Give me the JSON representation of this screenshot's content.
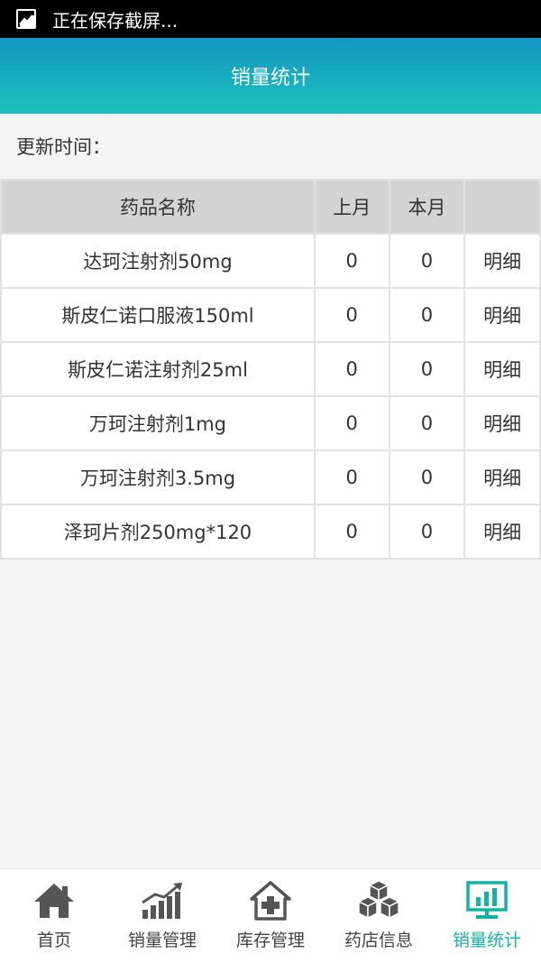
{
  "status_bar": {
    "text": "正在保存截屏..."
  },
  "header": {
    "title": "销量统计"
  },
  "update": {
    "label": "更新时间："
  },
  "table": {
    "headers": [
      "药品名称",
      "上月",
      "本月",
      ""
    ],
    "rows": [
      {
        "name": "达珂注射剂50mg",
        "last": "0",
        "this": "0",
        "detail": "明细"
      },
      {
        "name": "斯皮仁诺口服液150ml",
        "last": "0",
        "this": "0",
        "detail": "明细"
      },
      {
        "name": "斯皮仁诺注射剂25ml",
        "last": "0",
        "this": "0",
        "detail": "明细"
      },
      {
        "name": "万珂注射剂1mg",
        "last": "0",
        "this": "0",
        "detail": "明细"
      },
      {
        "name": "万珂注射剂3.5mg",
        "last": "0",
        "this": "0",
        "detail": "明细"
      },
      {
        "name": "泽珂片剂250mg*120",
        "last": "0",
        "this": "0",
        "detail": "明细"
      }
    ]
  },
  "tabs": [
    {
      "label": "首页",
      "icon": "home-icon"
    },
    {
      "label": "销量管理",
      "icon": "trend-chart-icon"
    },
    {
      "label": "库存管理",
      "icon": "inventory-house-icon"
    },
    {
      "label": "药店信息",
      "icon": "boxes-icon"
    },
    {
      "label": "销量统计",
      "icon": "monitor-chart-icon",
      "active": true
    }
  ],
  "colors": {
    "accent": "#14b2a4",
    "header_start": "#1596c4",
    "header_end": "#1cc0b8"
  }
}
